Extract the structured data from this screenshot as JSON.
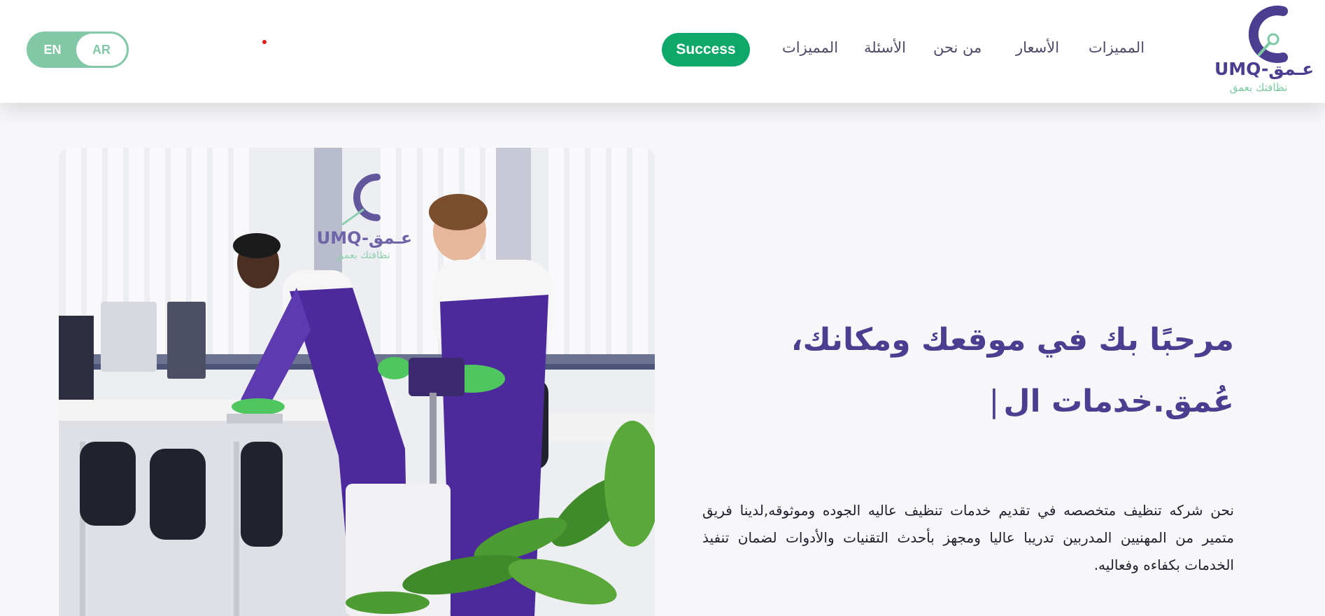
{
  "logo": {
    "brand": "UMQ-عـمق",
    "tagline": "نظافتك بعمق",
    "colors": {
      "primary": "#4b3d8f",
      "accent": "#7cc9a4"
    }
  },
  "nav": {
    "items": [
      {
        "label": "المميزات"
      },
      {
        "label": "الأسعار"
      },
      {
        "label": "من نحن"
      },
      {
        "label": "الأسئلة"
      },
      {
        "label": "المميزات"
      }
    ],
    "success_button": "Success"
  },
  "language": {
    "en_label": "EN",
    "ar_label": "AR",
    "active": "AR"
  },
  "hero": {
    "headline_line1": "مرحبًا بك في موقعك ومكانك،",
    "headline_line2": "عُمق.خدمات ال",
    "caret": "|",
    "description": "نحن شركه تنظيف متخصصه في تقديم خدمات تنظيف عاليه الجوده وموثوقه,لدينا فريق متمير من المهنيين المدربين تدريبا عاليا ومجهز بأحدث التقنيات والأدوات لضمان تنفيذ الخدمات بكفاءه وفعاليه.",
    "image_watermark_brand": "UMQ-عـمق",
    "image_watermark_tagline": "نظافتك بعمق"
  },
  "colors": {
    "brand_purple": "#4b3d8f",
    "brand_green": "#0ea96a",
    "toggle_green": "#82c8a6"
  }
}
